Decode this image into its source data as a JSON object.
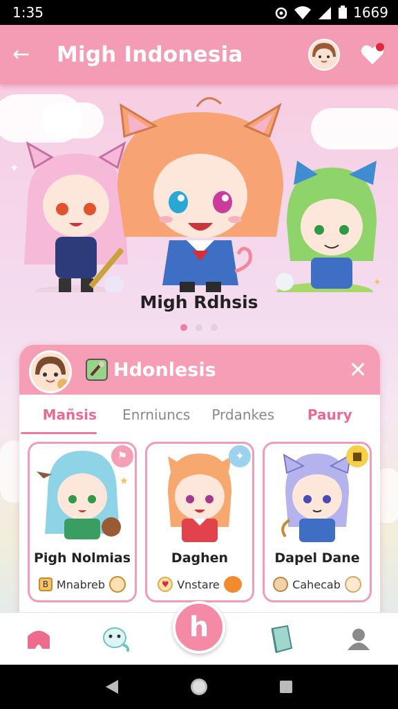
{
  "status": {
    "time": "1:35",
    "battery": "1669"
  },
  "header": {
    "title": "Migh Indonesia"
  },
  "hero": {
    "caption": "Migh Rdhsis",
    "dots": 3,
    "active_dot": 0
  },
  "card": {
    "title": "Hdonlesis",
    "tabs": [
      {
        "label": "Mañsis"
      },
      {
        "label": "Enrniuncs"
      },
      {
        "label": "Prdankes"
      },
      {
        "label": "Paury"
      }
    ],
    "tiles": [
      {
        "name": "Pigh Nolmias",
        "tag": "Mnabreb",
        "hair": "#8fd3e6",
        "outfit": "#3a9e63"
      },
      {
        "name": "Daghen",
        "tag": "Vnstare",
        "hair": "#f7a86e",
        "outfit": "#e1424c"
      },
      {
        "name": "Dapel Dane",
        "tag": "Cahecab",
        "hair": "#b5b3ee",
        "outfit": "#3f6fc4"
      }
    ]
  },
  "colors": {
    "accent": "#f39cb4",
    "accent_dark": "#e96a93"
  },
  "nav": {
    "items": [
      "home-icon",
      "pet-icon",
      "create-button",
      "book-icon",
      "profile-icon"
    ]
  }
}
